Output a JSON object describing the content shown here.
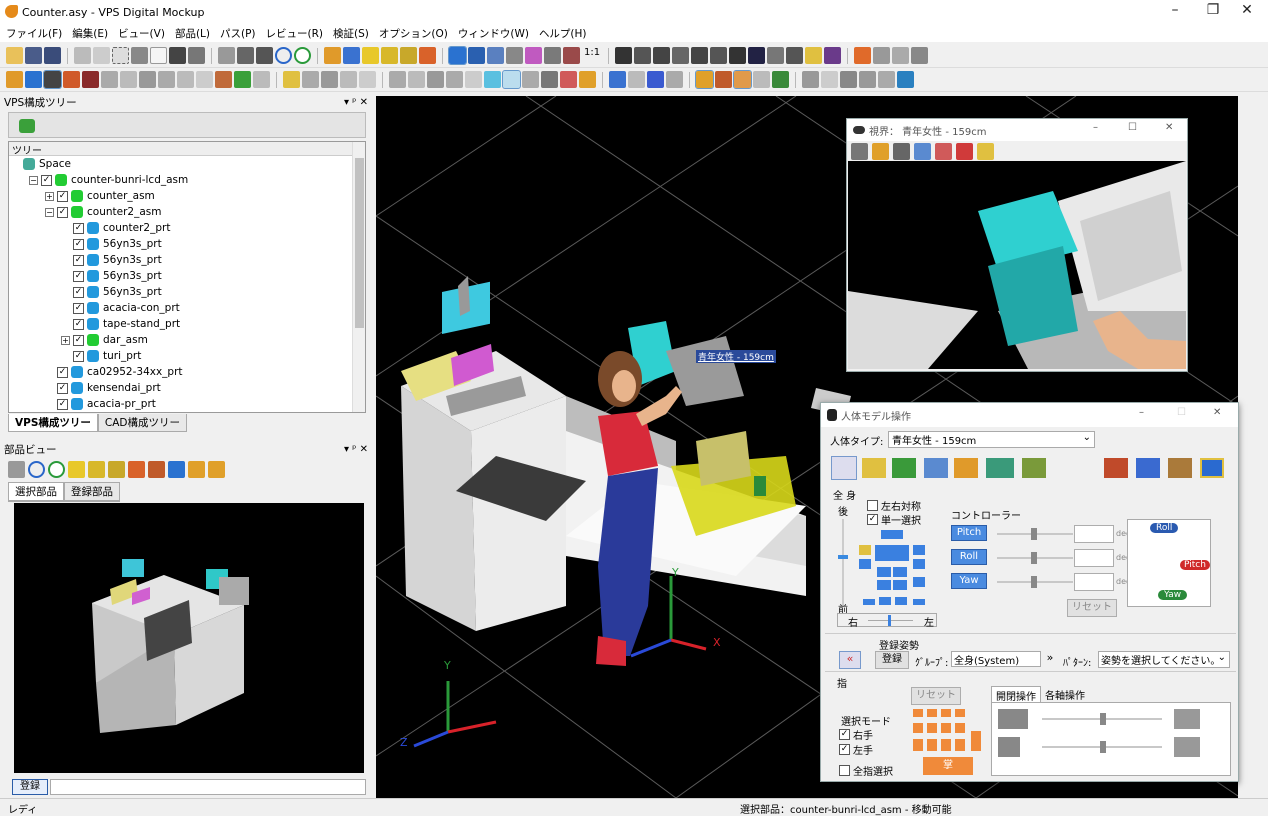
{
  "window": {
    "title": "Counter.asy - VPS Digital Mockup",
    "min": "–",
    "max": "❐",
    "close": "✕"
  },
  "menu": [
    "ファイル(F)",
    "編集(E)",
    "ビュー(V)",
    "部品(L)",
    "パス(P)",
    "レビュー(R)",
    "検証(S)",
    "オプション(O)",
    "ウィンドウ(W)",
    "ヘルプ(H)"
  ],
  "toolbar": {
    "scale_label": "1:1"
  },
  "tree_panel": {
    "title": "VPS構成ツリー",
    "pin": "▾ ᵖ ✕",
    "tree_header": "ツリー",
    "items": [
      {
        "label": "Space",
        "indent": 0,
        "pm": "",
        "chk": false,
        "color": "#4a9"
      },
      {
        "label": "counter-bunri-lcd_asm",
        "indent": 1,
        "pm": "⊟",
        "chk": true,
        "color": "#2c3"
      },
      {
        "label": "counter_asm",
        "indent": 2,
        "pm": "⊞",
        "chk": true,
        "color": "#2c3"
      },
      {
        "label": "counter2_asm",
        "indent": 2,
        "pm": "⊟",
        "chk": true,
        "color": "#2c3"
      },
      {
        "label": "counter2_prt",
        "indent": 3,
        "pm": "",
        "chk": true,
        "color": "#29d"
      },
      {
        "label": "56yn3s_prt",
        "indent": 3,
        "pm": "",
        "chk": true,
        "color": "#29d"
      },
      {
        "label": "56yn3s_prt",
        "indent": 3,
        "pm": "",
        "chk": true,
        "color": "#29d"
      },
      {
        "label": "56yn3s_prt",
        "indent": 3,
        "pm": "",
        "chk": true,
        "color": "#29d"
      },
      {
        "label": "56yn3s_prt",
        "indent": 3,
        "pm": "",
        "chk": true,
        "color": "#29d"
      },
      {
        "label": "acacia-con_prt",
        "indent": 3,
        "pm": "",
        "chk": true,
        "color": "#29d"
      },
      {
        "label": "tape-stand_prt",
        "indent": 3,
        "pm": "",
        "chk": true,
        "color": "#29d"
      },
      {
        "label": "dar_asm",
        "indent": 3,
        "pm": "⊞",
        "chk": true,
        "color": "#2c3"
      },
      {
        "label": "turi_prt",
        "indent": 3,
        "pm": "",
        "chk": true,
        "color": "#29d"
      },
      {
        "label": "ca02952-34xx_prt",
        "indent": 2,
        "pm": "",
        "chk": true,
        "color": "#29d"
      },
      {
        "label": "kensendai_prt",
        "indent": 2,
        "pm": "",
        "chk": true,
        "color": "#29d"
      },
      {
        "label": "acacia-pr_prt",
        "indent": 2,
        "pm": "",
        "chk": true,
        "color": "#29d"
      }
    ],
    "tabs": [
      "VPS構成ツリー",
      "CAD構成ツリー"
    ]
  },
  "parts_panel": {
    "title": "部品ビュー",
    "pin": "▾ ᵖ ✕",
    "tabs": [
      "選択部品",
      "登録部品"
    ],
    "register_btn": "登録"
  },
  "view_window": {
    "title": "視界： 青年女性 - 159cm",
    "min": "–",
    "max": "☐",
    "close": "✕"
  },
  "figure_label": "青年女性 - 159cm",
  "axes": {
    "x": "X",
    "y": "Y",
    "z": "Z"
  },
  "human_dialog": {
    "title": "人体モデル操作",
    "min": "–",
    "max": "☐",
    "close": "✕",
    "type_label": "人体タイプ:",
    "type_value": "青年女性 - 159cm",
    "whole_body": "全 身",
    "back": "後",
    "front": "前",
    "right": "右",
    "left": "左",
    "symmetric": "左右対称",
    "single_select": "単一選択",
    "controller": "コントローラー",
    "pitch": "Pitch",
    "roll": "Roll",
    "yaw": "Yaw",
    "deg": "deg.",
    "reset": "リセット",
    "gauge_roll": "Roll",
    "gauge_pitch": "Pitch",
    "gauge_yaw": "Yaw",
    "posture_title": "登録姿勢",
    "register": "登録",
    "group_label": "ｸﾞﾙｰﾌﾟ:",
    "group_value": "全身(System)",
    "pattern_label": "ﾊﾟﾀｰﾝ:",
    "pattern_value": "姿勢を選択してください。",
    "finger": "指",
    "finger_reset": "リセット",
    "tab_open": "開閉操作",
    "tab_axis": "各軸操作",
    "select_mode": "選択モード",
    "right_hand": "右手",
    "left_hand": "左手",
    "all_fingers": "全指選択",
    "palm": "掌"
  },
  "status": {
    "left": "レディ",
    "center": "選択部品：counter-bunri-lcd_asm - 移動可能"
  }
}
